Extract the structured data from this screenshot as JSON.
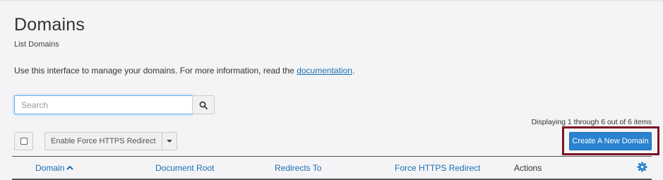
{
  "page": {
    "title": "Domains",
    "subtitle": "List Domains",
    "intro_text": "Use this interface to manage your domains. For more information, read the ",
    "intro_link": "documentation",
    "intro_end": "."
  },
  "search": {
    "placeholder": "Search",
    "value": ""
  },
  "display_count": "Displaying 1 through 6 out of 6 items",
  "toolbar": {
    "force_https_label": "Enable Force HTTPS Redirect",
    "create_label": "Create A New Domain"
  },
  "table": {
    "columns": [
      {
        "label": "Domain",
        "sortable": true,
        "sort": "ascending"
      },
      {
        "label": "Document Root",
        "sortable": true
      },
      {
        "label": "Redirects To",
        "sortable": true
      },
      {
        "label": "Force HTTPS Redirect",
        "sortable": true
      },
      {
        "label": "Actions",
        "sortable": false
      }
    ]
  },
  "colors": {
    "accent": "#2a82d0",
    "link": "#1a6fb3",
    "highlight": "#7d1326",
    "background": "#f4f4f6"
  },
  "icons": {
    "search": "search-icon",
    "sort": "sort-ascending-icon",
    "settings": "gear-icon",
    "dropdown": "caret-down-icon"
  }
}
